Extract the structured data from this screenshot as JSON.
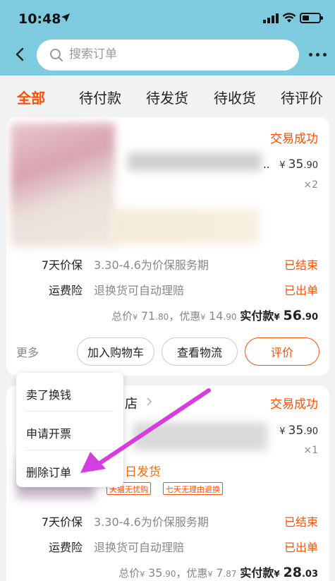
{
  "status_bar": {
    "time": "10:48"
  },
  "search": {
    "placeholder": "搜索订单"
  },
  "tabs": [
    {
      "label": "全部",
      "active": true
    },
    {
      "label": "待付款",
      "active": false
    },
    {
      "label": "待发货",
      "active": false
    },
    {
      "label": "待收货",
      "active": false
    },
    {
      "label": "待评价",
      "active": false
    }
  ],
  "orders": [
    {
      "status": "交易成功",
      "title_tail": "..",
      "price_symbol": "¥",
      "price_int": "35",
      "price_dec": ".90",
      "quantity": "×2",
      "protection_label": "7天价保",
      "protection_value": "3.30-4.6为价保服务期",
      "protection_status": "已结束",
      "insurance_label": "运费险",
      "insurance_value": "退换货可自动理赔",
      "insurance_status": "已出单",
      "total_prefix": "总价",
      "total_int": "71",
      "total_dec": ".80",
      "discount_prefix": "，优惠",
      "discount_int": "14",
      "discount_dec": ".90",
      "paid_prefix": "实付款",
      "paid_int": "56",
      "paid_dec": ".90",
      "more_label": "更多",
      "buttons": [
        "加入购物车",
        "查看物流",
        "评价"
      ]
    },
    {
      "shop_suffix": "店",
      "status": "交易成功",
      "price_symbol": "¥",
      "price_int": "35",
      "price_dec": ".90",
      "quantity": "×1",
      "ship_text": "日发货",
      "tags": [
        "天猫无忧购",
        "七天无理由退换"
      ],
      "protection_label": "7天价保",
      "protection_value": "3.30-4.6为价保服务期",
      "protection_status": "已结束",
      "insurance_label": "运费险",
      "insurance_value": "退换货可自动理赔",
      "insurance_status": "已出单",
      "total_prefix": "总价",
      "total_int": "35",
      "total_dec": ".90",
      "discount_prefix": "，优惠",
      "discount_int": "7",
      "discount_dec": ".87",
      "paid_prefix": "实付款",
      "paid_int": "28",
      "paid_dec": ".03"
    }
  ],
  "popup_menu": {
    "items": [
      "卖了换钱",
      "申请开票",
      "删除订单"
    ]
  },
  "colors": {
    "header_bg": "#7ecbe0",
    "accent": "#ff5000",
    "annotation_arrow": "#d63de0"
  },
  "icons": [
    "location-arrow-icon",
    "signal-icon",
    "wifi-icon",
    "battery-icon",
    "back-arrow-icon",
    "search-icon",
    "more-dots-icon",
    "chevron-right-icon",
    "annotation-arrow"
  ]
}
